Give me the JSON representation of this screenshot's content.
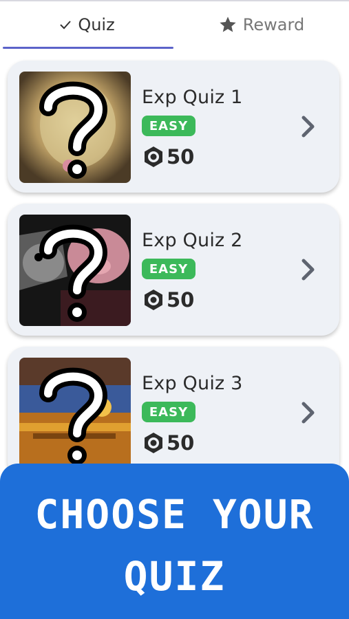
{
  "tabs": {
    "quiz_label": "Quiz",
    "reward_label": "Reward"
  },
  "quizzes": [
    {
      "title": "Exp Quiz 1",
      "difficulty": "EASY",
      "reward": "50"
    },
    {
      "title": "Exp Quiz 2",
      "difficulty": "EASY",
      "reward": "50"
    },
    {
      "title": "Exp Quiz 3",
      "difficulty": "EASY",
      "reward": "50"
    }
  ],
  "banner": {
    "line1": "CHOOSE YOUR",
    "line2": "QUIZ"
  },
  "colors": {
    "accent": "#5b63c9",
    "badge": "#3cb95a",
    "banner": "#1e6fd9",
    "card": "#eef1f6"
  },
  "icons": {
    "quiz_tab": "check-icon",
    "reward_tab": "star-icon",
    "reward": "coin-icon",
    "card_action": "chevron-right-icon",
    "thumbnail": "question-mark-icon"
  }
}
